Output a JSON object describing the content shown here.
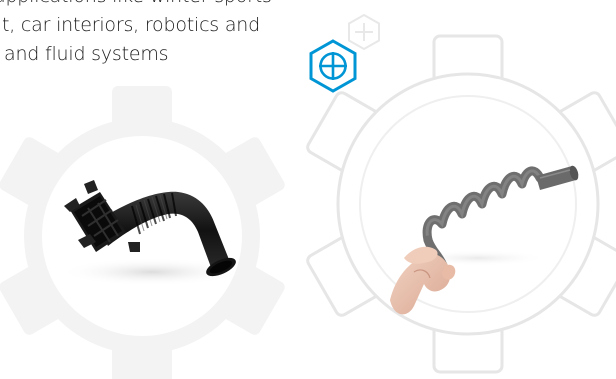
{
  "description": {
    "lines": [
      "applications like winter sports",
      "t, car interiors, robotics and",
      "and fluid systems"
    ]
  },
  "icons": {
    "plus_hex_primary": "plus-hexagon-icon",
    "plus_hex_faint": "plus-hexagon-icon"
  },
  "colors": {
    "accent": "#0096d6",
    "gear_fill": "#f3f3f3",
    "gear_outline": "#e6e6e6",
    "part_dark": "#1e1e1e",
    "spring_gray": "#6f6f6f"
  }
}
